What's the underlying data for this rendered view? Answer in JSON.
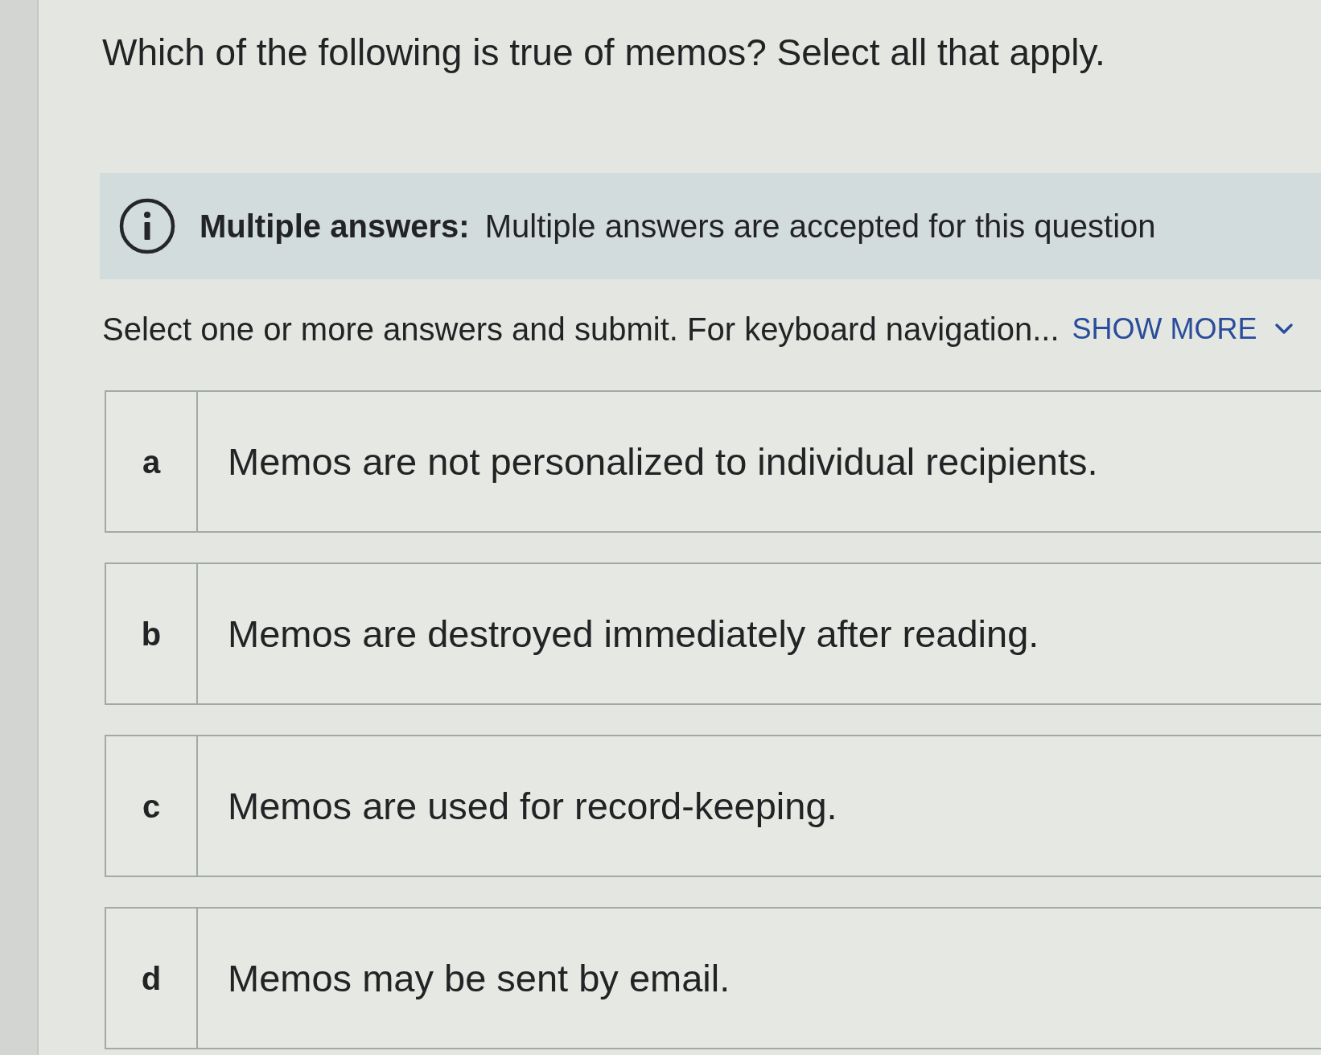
{
  "question": {
    "text": "Which of the following is true of memos? Select all that apply."
  },
  "notice": {
    "text": "**Multiple answers:** Multiple answers are accepted for this question"
  },
  "instructions": {
    "text": "Select one or more answers and submit. For keyboard navigation...",
    "link": "SHOW MORE",
    "expanded": false
  },
  "options": [
    {
      "letter": "a",
      "text": "Memos are not personalized to individual recipients.",
      "selected": false
    },
    {
      "letter": "b",
      "text": "Memos are destroyed immediately after reading.",
      "selected": false
    },
    {
      "letter": "c",
      "text": "Memos are used for record-keeping.",
      "selected": false
    },
    {
      "letter": "d",
      "text": "Memos may be sent by email.",
      "selected": false
    }
  ]
}
